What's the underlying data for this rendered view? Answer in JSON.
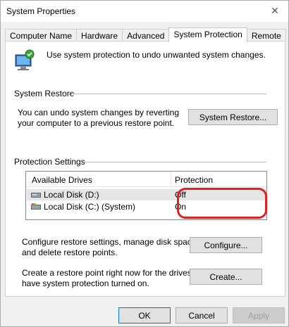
{
  "window": {
    "title": "System Properties",
    "close_glyph": "✕"
  },
  "tabs": [
    {
      "label": "Computer Name"
    },
    {
      "label": "Hardware"
    },
    {
      "label": "Advanced"
    },
    {
      "label": "System Protection",
      "active": true
    },
    {
      "label": "Remote"
    }
  ],
  "intro": {
    "text": "Use system protection to undo unwanted system changes.",
    "icon": "system-protection-icon"
  },
  "system_restore": {
    "heading": "System Restore",
    "description_line1": "You can undo system changes by reverting",
    "description_line2": "your computer to a previous restore point.",
    "button_label": "System Restore..."
  },
  "protection_settings": {
    "heading": "Protection Settings",
    "columns": [
      "Available Drives",
      "Protection"
    ],
    "drives": [
      {
        "name": "Local Disk (D:)",
        "protection": "Off",
        "selected": true,
        "icon": "drive-icon"
      },
      {
        "name": "Local Disk (C:) (System)",
        "protection": "On",
        "selected": false,
        "icon": "system-drive-icon"
      }
    ],
    "configure_text_line1": "Configure restore settings, manage disk space,",
    "configure_text_line2": "and delete restore points.",
    "configure_button": "Configure...",
    "create_text_line1": "Create a restore point right now for the drives that",
    "create_text_line2": "have system protection turned on.",
    "create_button": "Create..."
  },
  "footer": {
    "ok": "OK",
    "cancel": "Cancel",
    "apply": "Apply"
  },
  "colors": {
    "highlight": "#e02020",
    "accent": "#0078d7"
  }
}
